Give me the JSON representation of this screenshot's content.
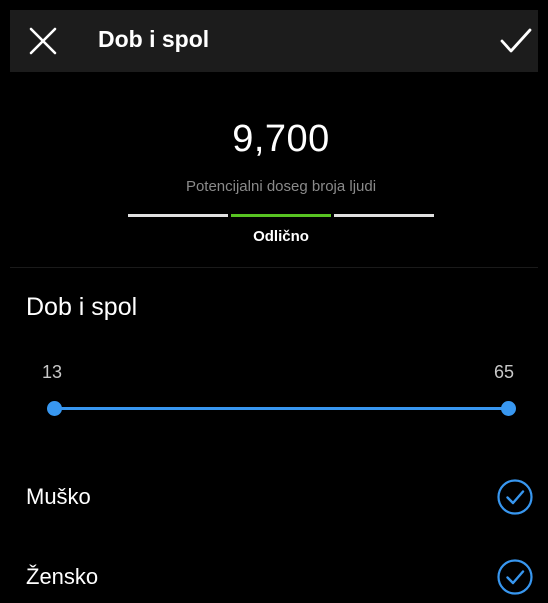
{
  "header": {
    "title": "Dob i spol",
    "close_icon": "close-icon",
    "confirm_icon": "checkmark-icon"
  },
  "reach": {
    "value": "9,700",
    "caption": "Potencijalni doseg broja ljudi",
    "quality_label": "Odlično",
    "quality_segments": [
      "poor",
      "good",
      "broad"
    ],
    "active_segment_index": 1
  },
  "age_gender": {
    "title": "Dob i spol",
    "age_min": "13",
    "age_max": "65",
    "options": [
      {
        "label": "Muško",
        "selected": true
      },
      {
        "label": "Žensko",
        "selected": true
      }
    ]
  },
  "colors": {
    "background": "#000000",
    "header_bg": "#1c1c1c",
    "accent_blue": "#3897f0",
    "quality_green": "#58c322",
    "segment_inactive": "#e0e0e0",
    "caption_gray": "#8a8a8a"
  }
}
